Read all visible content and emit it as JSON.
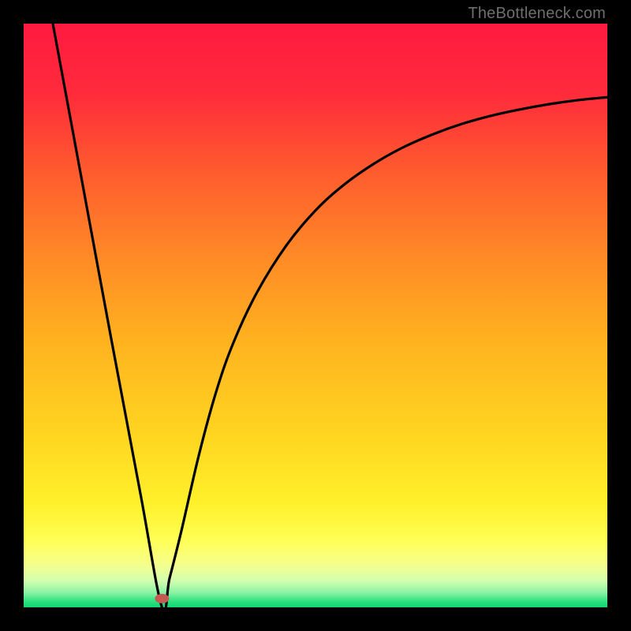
{
  "watermark": "TheBottleneck.com",
  "gradient": {
    "stops": [
      {
        "offset": 0.0,
        "color": "#ff1a40"
      },
      {
        "offset": 0.12,
        "color": "#ff2b3b"
      },
      {
        "offset": 0.25,
        "color": "#ff5a2e"
      },
      {
        "offset": 0.4,
        "color": "#ff8a26"
      },
      {
        "offset": 0.55,
        "color": "#ffb41f"
      },
      {
        "offset": 0.7,
        "color": "#ffd420"
      },
      {
        "offset": 0.82,
        "color": "#fff02a"
      },
      {
        "offset": 0.885,
        "color": "#ffff55"
      },
      {
        "offset": 0.925,
        "color": "#f7ff8a"
      },
      {
        "offset": 0.955,
        "color": "#d2ffb0"
      },
      {
        "offset": 0.975,
        "color": "#8af2a2"
      },
      {
        "offset": 0.99,
        "color": "#2de27f"
      },
      {
        "offset": 1.0,
        "color": "#0fd66f"
      }
    ]
  },
  "marker": {
    "x_frac": 0.237,
    "y_frac": 0.985,
    "rx": 9,
    "ry": 6,
    "fill": "#c55a52"
  },
  "chart_data": {
    "type": "line",
    "title": "",
    "xlabel": "",
    "ylabel": "",
    "xlim": [
      0,
      100
    ],
    "ylim": [
      0,
      100
    ],
    "series": [
      {
        "name": "bottleneck-curve",
        "x": [
          5,
          10,
          15,
          20,
          23.7,
          25,
          27,
          30,
          33,
          36,
          40,
          45,
          50,
          55,
          60,
          65,
          70,
          75,
          80,
          85,
          90,
          95,
          100
        ],
        "y": [
          100,
          73,
          46,
          19.5,
          0,
          5,
          13,
          26,
          37,
          45.5,
          54,
          62,
          68,
          72.5,
          76,
          78.8,
          81,
          82.8,
          84.2,
          85.3,
          86.2,
          86.9,
          87.4
        ]
      }
    ],
    "annotations": [
      {
        "name": "minimum-marker",
        "x": 23.7,
        "y": 1.5
      }
    ]
  }
}
